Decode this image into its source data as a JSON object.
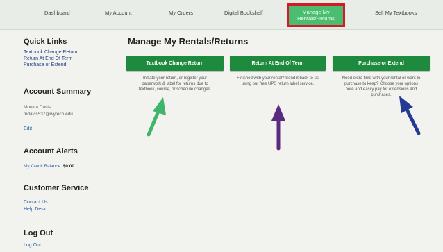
{
  "nav": {
    "items": [
      "Dashboard",
      "My Account",
      "My Orders",
      "Digital Bookshelf",
      "Sell My Textbooks"
    ],
    "active_line1": "Manage My",
    "active_line2": "Rentals/Returns"
  },
  "sidebar": {
    "quick_links_title": "Quick Links",
    "quick_links": [
      "Textbook Change Return",
      "Return At End Of Term",
      "Purchase or Extend"
    ],
    "account_summary_title": "Account Summary",
    "account_name": "Monica Davis",
    "account_email": "mdavis537@wytech.edu",
    "edit_label": "Edit",
    "alerts_title": "Account Alerts",
    "credit_label": "My Credit Balance:",
    "credit_value": "$0.00",
    "customer_service_title": "Customer Service",
    "contact_label": "Contact Us",
    "help_label": "Help Desk",
    "logout_title": "Log Out",
    "logout_link": "Log Out"
  },
  "main": {
    "title": "Manage My Rentals/Returns",
    "buttons": [
      "Textbook Change Return",
      "Return At End Of Term",
      "Purchase or Extend"
    ],
    "descriptions": [
      [
        "Initiate your return, or register your",
        "paperwork & label for returns due to",
        "textbook, course, or schedule changes."
      ],
      [
        "Finished with your rental? Send it back to us",
        "using our free UPS return label service."
      ],
      [
        "Need extra time with your rental or want to",
        "purchase to keep? Choose your options",
        "here and easily pay for extensions and",
        "purchases."
      ]
    ]
  },
  "colors": {
    "button_green": "#1e8a3d",
    "active_tab": "#4bbd70",
    "highlight_border": "#d41a24",
    "arrow_green": "#3fb56b",
    "arrow_purple": "#5a2a80",
    "arrow_blue": "#243b96"
  }
}
